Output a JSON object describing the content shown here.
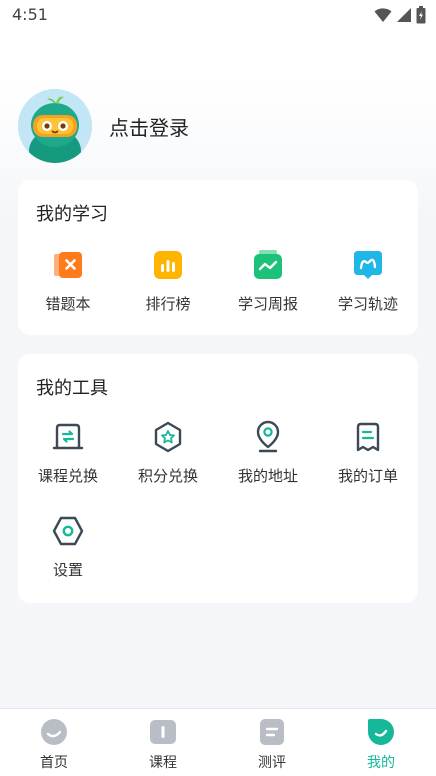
{
  "status_bar": {
    "time": "4:51"
  },
  "profile": {
    "login_text": "点击登录"
  },
  "learning": {
    "title": "我的学习",
    "items": [
      {
        "label": "错题本",
        "icon": "wrong-book-icon",
        "color": "#ff7a1a"
      },
      {
        "label": "排行榜",
        "icon": "ranking-icon",
        "color": "#ffb400"
      },
      {
        "label": "学习周报",
        "icon": "weekly-report-icon",
        "color": "#1dc27a"
      },
      {
        "label": "学习轨迹",
        "icon": "learning-track-icon",
        "color": "#1fb6e8"
      }
    ]
  },
  "tools": {
    "title": "我的工具",
    "items": [
      {
        "label": "课程兑换",
        "icon": "course-exchange-icon"
      },
      {
        "label": "积分兑换",
        "icon": "points-exchange-icon"
      },
      {
        "label": "我的地址",
        "icon": "address-icon"
      },
      {
        "label": "我的订单",
        "icon": "order-icon"
      },
      {
        "label": "设置",
        "icon": "settings-icon"
      }
    ]
  },
  "bottom_nav": {
    "active_index": 3,
    "active_color": "#16b89a",
    "items": [
      {
        "label": "首页",
        "icon": "home-icon"
      },
      {
        "label": "课程",
        "icon": "course-icon"
      },
      {
        "label": "测评",
        "icon": "assessment-icon"
      },
      {
        "label": "我的",
        "icon": "mine-icon"
      }
    ]
  }
}
